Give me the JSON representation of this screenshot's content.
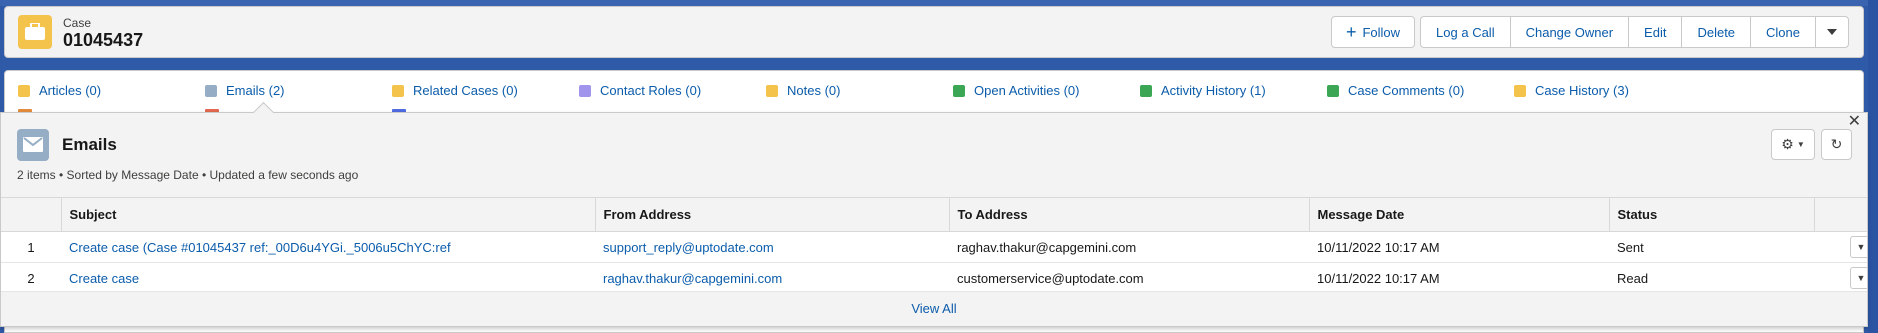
{
  "colors": {
    "brand_blue": "#0b5cab",
    "case_icon": "#f4c34b",
    "email_icon": "#95aec5",
    "background": "#2f5aa8"
  },
  "header": {
    "object_type": "Case",
    "record_number": "01045437",
    "icon": "briefcase-icon",
    "actions": {
      "follow": "Follow",
      "log_a_call": "Log a Call",
      "change_owner": "Change Owner",
      "edit": "Edit",
      "delete": "Delete",
      "clone": "Clone"
    }
  },
  "related_links": [
    {
      "label": "Articles (0)",
      "icon_color": "#f4c34b"
    },
    {
      "label": "Emails (2)",
      "icon_color": "#95aec5"
    },
    {
      "label": "Related Cases (0)",
      "icon_color": "#f4c34b"
    },
    {
      "label": "Contact Roles (0)",
      "icon_color": "#a094ed"
    },
    {
      "label": "Notes (0)",
      "icon_color": "#f4c34b"
    },
    {
      "label": "Open Activities (0)",
      "icon_color": "#3ba755"
    },
    {
      "label": "Activity History (1)",
      "icon_color": "#3ba755"
    },
    {
      "label": "Case Comments (0)",
      "icon_color": "#3ba755"
    },
    {
      "label": "Case History (3)",
      "icon_color": "#f4c34b"
    }
  ],
  "emails_panel": {
    "title": "Emails",
    "meta": "2 items • Sorted by Message Date • Updated a few seconds ago",
    "columns": [
      "Subject",
      "From Address",
      "To Address",
      "Message Date",
      "Status"
    ],
    "rows": [
      {
        "num": "1",
        "subject": "Create case (Case #01045437 ref:_00D6u4YGi._5006u5ChYC:ref",
        "from": "support_reply@uptodate.com",
        "to": "raghav.thakur@capgemini.com",
        "date": "10/11/2022 10:17 AM",
        "status": "Sent"
      },
      {
        "num": "2",
        "subject": "Create case",
        "from": "raghav.thakur@capgemini.com",
        "to": "customerservice@uptodate.com",
        "date": "10/11/2022 10:17 AM",
        "status": "Read"
      }
    ],
    "view_all": "View All"
  }
}
